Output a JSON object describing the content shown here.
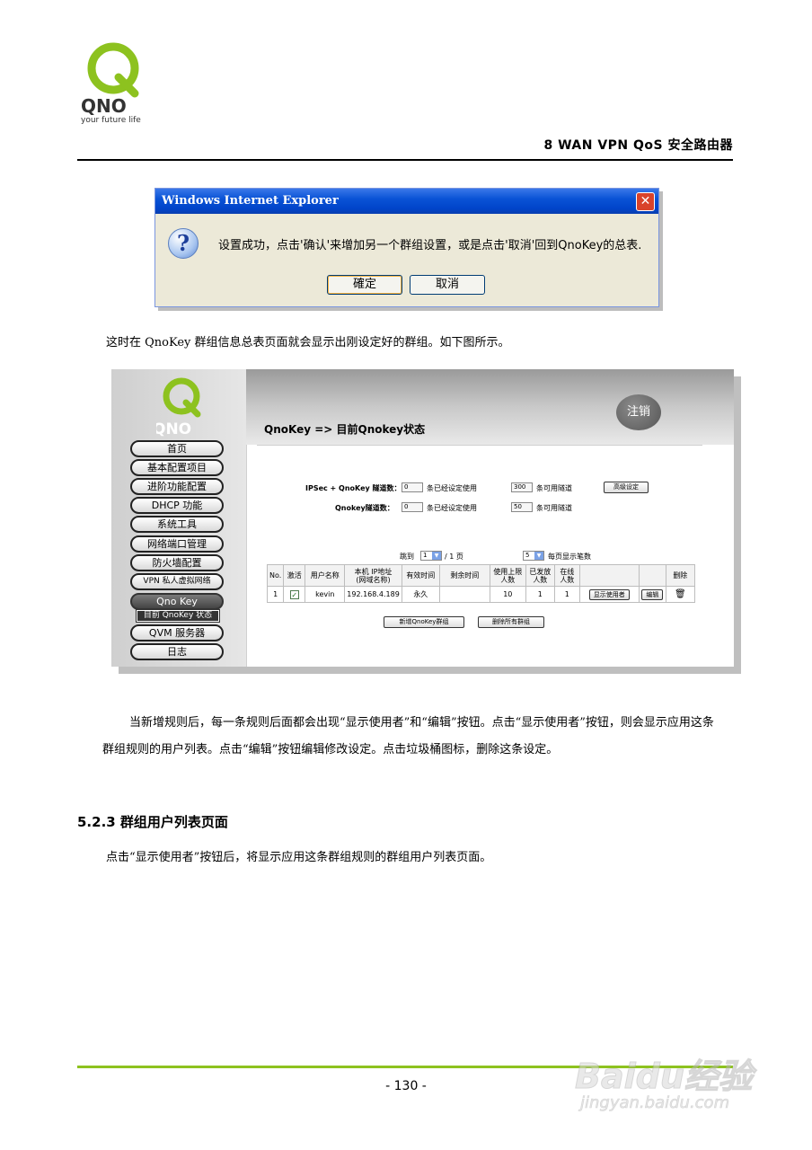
{
  "header": {
    "logo_tagline": "your future life",
    "logo_text": "QNO",
    "title": "8 WAN VPN QoS 安全路由器"
  },
  "dialog": {
    "title": "Windows Internet Explorer",
    "message": "设置成功，点击'确认'来增加另一个群组设置，或是点击'取消'回到QnoKey的总表.",
    "ok_label": "確定",
    "cancel_label": "取消",
    "close_glyph": "✕",
    "icon_glyph": "?"
  },
  "paragraphs": {
    "p1": "这时在 QnoKey 群组信息总表页面就会显示出刚设定好的群组。如下图所示。",
    "p2": "当新增规则后，每一条规则后面都会出现“显示使用者”和“编辑”按钮。点击“显示使用者”按钮，则会显示应用这条群组规则的用户列表。点击“编辑”按钮编辑修改设定。点击垃圾桶图标，删除这条设定。",
    "section_heading": "5.2.3 群组用户列表页面",
    "p3": "点击“显示使用者”按钮后，将显示应用这条群组规则的群组用户列表页面。"
  },
  "screenshot": {
    "logo_text": "QNO",
    "logout_label": "注销",
    "page_title": "QnoKey => 目前Qnokey状态",
    "menu": [
      {
        "label": "首页"
      },
      {
        "label": "基本配置项目"
      },
      {
        "label": "进阶功能配置"
      },
      {
        "label": "DHCP 功能"
      },
      {
        "label": "系统工具"
      },
      {
        "label": "网络端口管理"
      },
      {
        "label": "防火墙配置"
      },
      {
        "label": "VPN 私人虚拟网络"
      },
      {
        "label": "Qno Key"
      },
      {
        "label": "QVM 服务器"
      },
      {
        "label": "日志"
      }
    ],
    "menu_sub_label": "目前 QnoKey 状态",
    "tunnels": {
      "ipsec_label": "IPSec + QnoKey 隧道数：",
      "ipsec_used": "0",
      "used_suffix": "条已经设定使用",
      "ipsec_available": "300",
      "available_suffix": "条可用隧道",
      "advanced_button": "高级设定",
      "qnokey_label": "Qnokey隧道数：",
      "qnokey_used": "0",
      "qnokey_available": "50"
    },
    "pager": {
      "goto_label": "跳到",
      "page_value": "1",
      "page_total": "/ 1 页",
      "per_page_value": "5",
      "per_page_label": "每页显示笔数"
    },
    "table": {
      "headers": [
        "No.",
        "激活",
        "用户名称",
        "本机 IP地址\n(网域名称)",
        "有效时间",
        "剩余时间",
        "使用上限\n人数",
        "已发放\n人数",
        "在线\n人数",
        "",
        "",
        "删除"
      ],
      "row": {
        "no": "1",
        "active_glyph": "✓",
        "user": "kevin",
        "ip": "192.168.4.189",
        "valid": "永久",
        "remaining": "",
        "limit": "10",
        "issued": "1",
        "online": "1",
        "show_users_button": "显示使用者",
        "edit_button": "编辑",
        "trash_glyph": "🗑"
      }
    },
    "add_button": "新增QnoKey群组",
    "delete_all_button": "删除所有群组"
  },
  "footer": {
    "page_number": "- 130 -",
    "watermark_line1": "Baidu经验",
    "watermark_line2": "jingyan.baidu.com"
  },
  "colors": {
    "brand_green": "#8dc21f",
    "ie_blue": "#0a53d6"
  }
}
